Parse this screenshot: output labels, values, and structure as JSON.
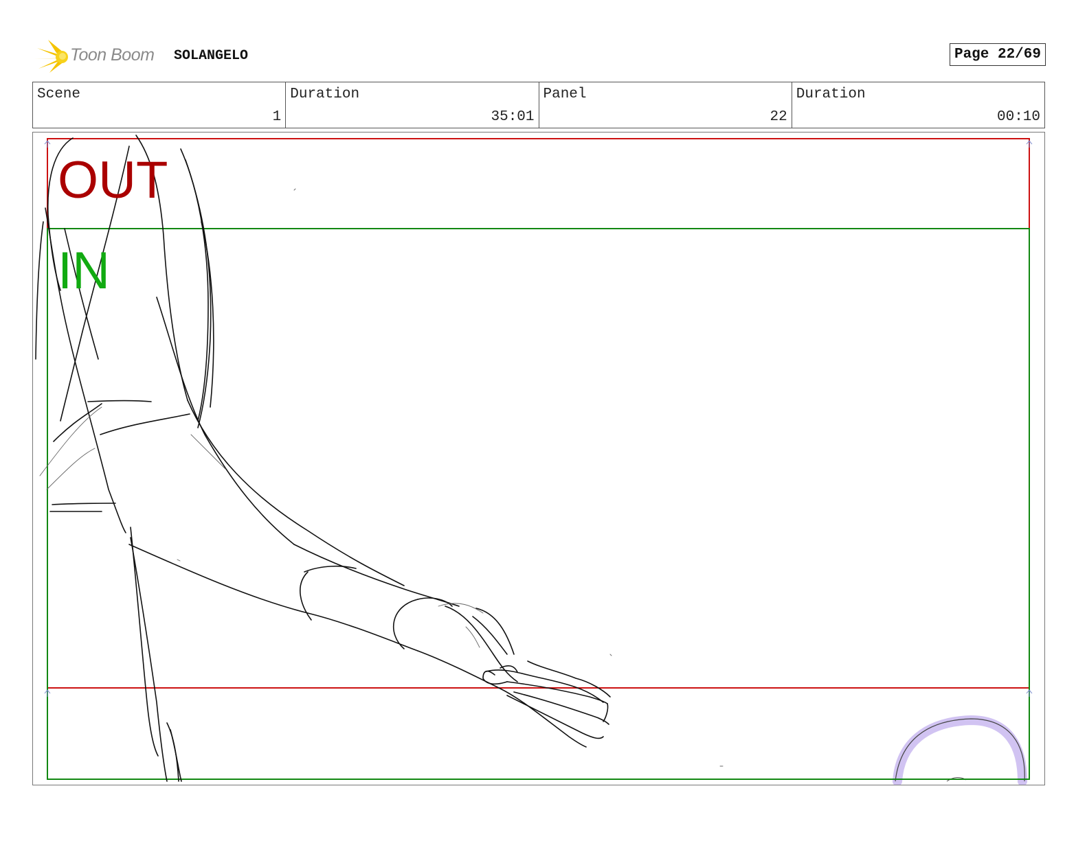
{
  "header": {
    "logo_text": "Toon Boom",
    "project_title": "SOLANGELO",
    "page_label": "Page 22/69"
  },
  "info": {
    "scene_label": "Scene",
    "scene_value": "1",
    "scene_duration_label": "Duration",
    "scene_duration_value": "35:01",
    "panel_label": "Panel",
    "panel_value": "22",
    "panel_duration_label": "Duration",
    "panel_duration_value": "00:10"
  },
  "panel": {
    "out_label": "OUT",
    "in_label": "IN",
    "colors": {
      "out_frame": "#cc1111",
      "in_frame": "#118811",
      "out_text": "#aa0000",
      "in_text": "#11aa11",
      "highlight": "#c9b8f0"
    }
  }
}
